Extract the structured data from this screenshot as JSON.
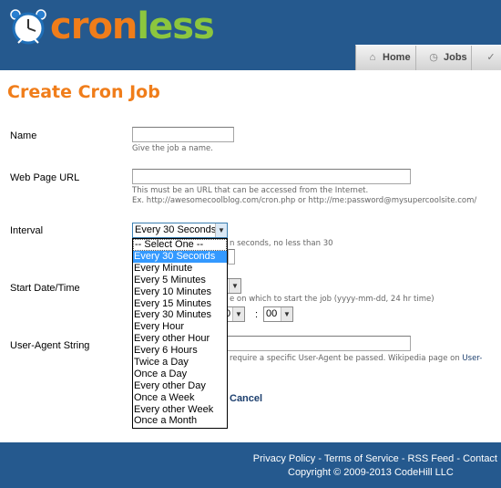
{
  "header": {
    "logo_text_a": "cron",
    "logo_text_b": "less",
    "nav": [
      {
        "label": "Home",
        "icon": "home-icon"
      },
      {
        "label": "Jobs",
        "icon": "clock-icon"
      },
      {
        "label": "",
        "icon": "check-icon"
      }
    ]
  },
  "page_title": "Create Cron Job",
  "form": {
    "name": {
      "label": "Name",
      "value": "",
      "help": "Give the job a name."
    },
    "url": {
      "label": "Web Page URL",
      "value": "",
      "help_line1": "This must be an URL that can be accessed from the Internet.",
      "help_line2": "Ex. http://awesomecoolblog.com/cron.php or http://me:password@mysupercoolsite.com/"
    },
    "interval": {
      "label": "Interval",
      "selected": "Every 30 Seconds",
      "help_partial": "n seconds, no less than 30",
      "options": [
        "-- Select One --",
        "Every 30 Seconds",
        "Every Minute",
        "Every 5 Minutes",
        "Every 10 Minutes",
        "Every 15 Minutes",
        "Every 30 Minutes",
        "Every Hour",
        "Every other Hour",
        "Every 6 Hours",
        "Twice a Day",
        "Once a Day",
        "Every other Day",
        "Once a Week",
        "Every other Week",
        "Once a Month"
      ],
      "highlighted_index": 1
    },
    "start": {
      "label": "Start Date/Time",
      "help_partial": "e on which to start the job (yyyy-mm-dd, 24 hr time)",
      "hour_value": "0",
      "minute_value": "00",
      "separator": ":"
    },
    "user_agent": {
      "label": "User-Agent String",
      "value": "",
      "help_partial": "require a specific User-Agent be passed. Wikipedia page on ",
      "help_link": "User-"
    },
    "cancel_label": "Cancel"
  },
  "footer": {
    "links": [
      "Privacy Policy",
      "Terms of Service",
      "RSS Feed",
      "Contact"
    ],
    "separator": " - ",
    "copyright": "Copyright © 2009-2013 CodeHill LLC"
  },
  "colors": {
    "header_bg": "#25598e",
    "title_orange": "#f07d1a",
    "logo_green": "#8cc63e",
    "selection_blue": "#3399ff"
  }
}
